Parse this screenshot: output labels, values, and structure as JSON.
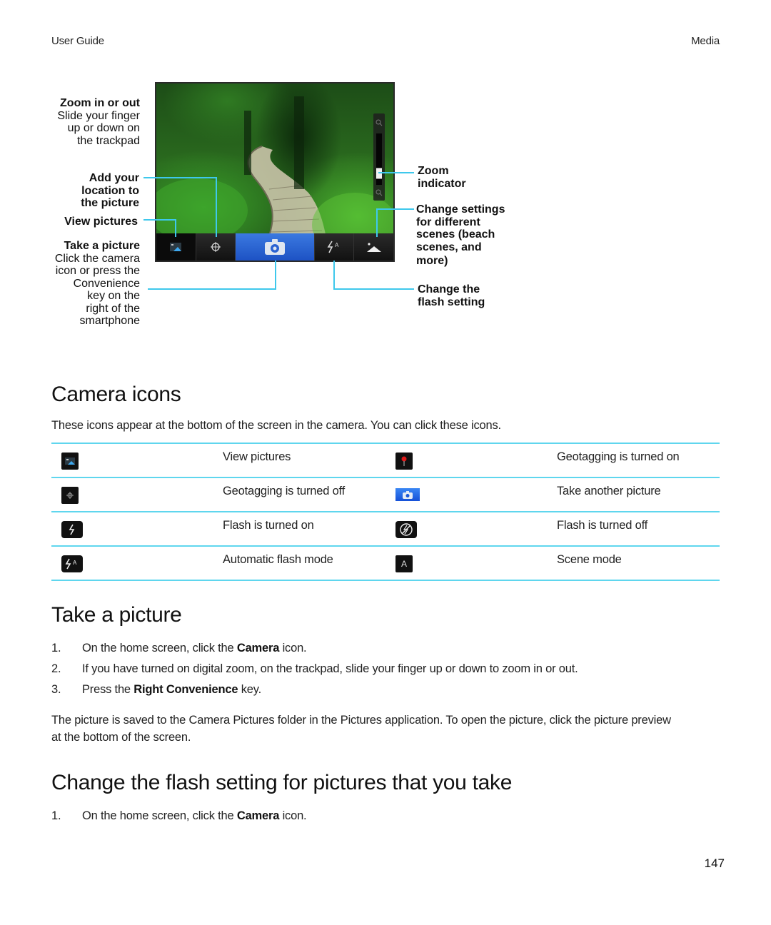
{
  "header": {
    "left": "User Guide",
    "right": "Media"
  },
  "figure": {
    "callouts_left": {
      "zoom_title": "Zoom in or out",
      "zoom_desc": [
        "Slide your finger",
        "up or down on",
        "the trackpad"
      ],
      "location": [
        "Add your",
        "location to",
        "the picture"
      ],
      "view": "View pictures",
      "take_title": "Take a picture",
      "take_desc": [
        "Click the camera",
        "icon or press the",
        "Convenience",
        "key on the",
        "right of the",
        "smartphone"
      ]
    },
    "callouts_right": {
      "zoom_indicator": [
        "Zoom",
        "indicator"
      ],
      "scene": [
        "Change settings",
        "for different",
        "scenes (beach",
        "scenes, and",
        "more)"
      ],
      "flash": [
        "Change the",
        "flash setting"
      ]
    },
    "toolbar_icons": [
      "view-pictures-icon",
      "geotag-crosshair-icon",
      "camera-icon",
      "flash-auto-icon",
      "scene-mode-icon"
    ],
    "flash_auto_label": "A",
    "zoom_level_fraction": 0.15,
    "accent_color": "#3ec8ec",
    "camera_button_color": "#2a62d2"
  },
  "camera_icons": {
    "title": "Camera icons",
    "intro": "These icons appear at the bottom of the screen in the camera. You can click these icons.",
    "rows": [
      {
        "left_icon": "view-pictures-icon",
        "left_label": "View pictures",
        "right_icon": "geotag-on-pin-icon",
        "right_label": "Geotagging is turned on"
      },
      {
        "left_icon": "geotag-off-icon",
        "left_label": "Geotagging is turned off",
        "right_icon": "take-picture-icon",
        "right_label": "Take another picture"
      },
      {
        "left_icon": "flash-on-icon",
        "left_label": "Flash is turned on",
        "right_icon": "flash-off-icon",
        "right_label": "Flash is turned off"
      },
      {
        "left_icon": "flash-auto-icon",
        "left_label": "Automatic flash mode",
        "right_icon": "scene-mode-icon",
        "right_label": "Scene mode"
      }
    ],
    "flash_auto_glyph": "A",
    "scene_glyph": "A"
  },
  "take_picture": {
    "title": "Take a picture",
    "steps": [
      {
        "num": "1.",
        "pre": "On the home screen, click the ",
        "bold": "Camera",
        "post": " icon."
      },
      {
        "num": "2.",
        "pre": "If you have turned on digital zoom, on the trackpad, slide your finger up or down to zoom in or out.",
        "bold": "",
        "post": ""
      },
      {
        "num": "3.",
        "pre": "Press the ",
        "bold": "Right Convenience",
        "post": " key."
      }
    ],
    "note_line1": "The picture is saved to the Camera Pictures folder in the Pictures application. To open the picture, click the picture preview",
    "note_line2": "at the bottom of the screen."
  },
  "change_flash": {
    "title": "Change the flash setting for pictures that you take",
    "steps": [
      {
        "num": "1.",
        "pre": "On the home screen, click the ",
        "bold": "Camera",
        "post": " icon."
      }
    ]
  },
  "page_number": "147"
}
